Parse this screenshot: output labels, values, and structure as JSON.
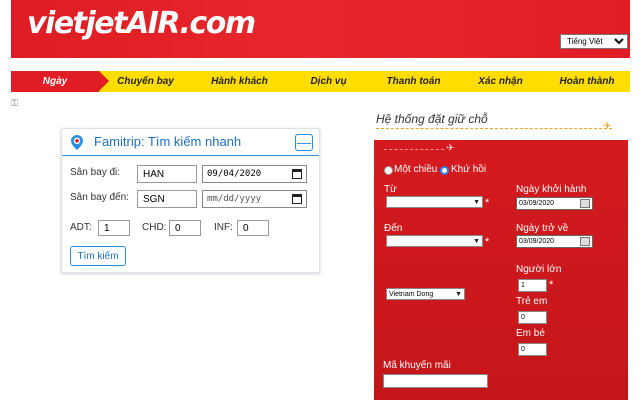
{
  "header": {
    "logo_text": "vietjetAIR.com",
    "language": "Tiếng Việt"
  },
  "steps": [
    {
      "label": "Ngày"
    },
    {
      "label": "Chuyến bay"
    },
    {
      "label": "Hành khách"
    },
    {
      "label": "Dịch vụ"
    },
    {
      "label": "Thanh toán"
    },
    {
      "label": "Xác nhận"
    },
    {
      "label": "Hoàn thành"
    }
  ],
  "famitrip": {
    "title": "Famitrip: Tìm kiếm nhanh",
    "minimize": "—",
    "from_label": "Sân bay đi:",
    "from_value": "HAN",
    "from_date": "09/04/2020",
    "to_label": "Sân bay đến:",
    "to_value": "SGN",
    "to_date": "mm/dd/yyyy",
    "adt_label": "ADT:",
    "adt_value": "1",
    "chd_label": "CHD:",
    "chd_value": "0",
    "inf_label": "INF:",
    "inf_value": "0",
    "search_button": "Tìm kiếm"
  },
  "booking": {
    "title": "Hệ thống đặt giữ chỗ",
    "oneway_label": "Một chiều",
    "roundtrip_label": "Khứ hồi",
    "from_label": "Từ",
    "depart_label": "Ngày khởi hành",
    "depart_date": "03/09/2020",
    "to_label": "Đến",
    "return_label": "Ngày trở về",
    "return_date": "03/09/2020",
    "currency": "Vietnam Dong",
    "adult_label": "Người lớn",
    "adult_value": "1",
    "child_label": "Trẻ em",
    "child_value": "0",
    "infant_label": "Em bé",
    "infant_value": "0",
    "promo_label": "Mã khuyến mãi",
    "required_mark": "*"
  },
  "colors": {
    "brand_red": "#e01d24",
    "brand_yellow": "#ffdd00",
    "famitrip_blue": "#2a8fe0"
  }
}
